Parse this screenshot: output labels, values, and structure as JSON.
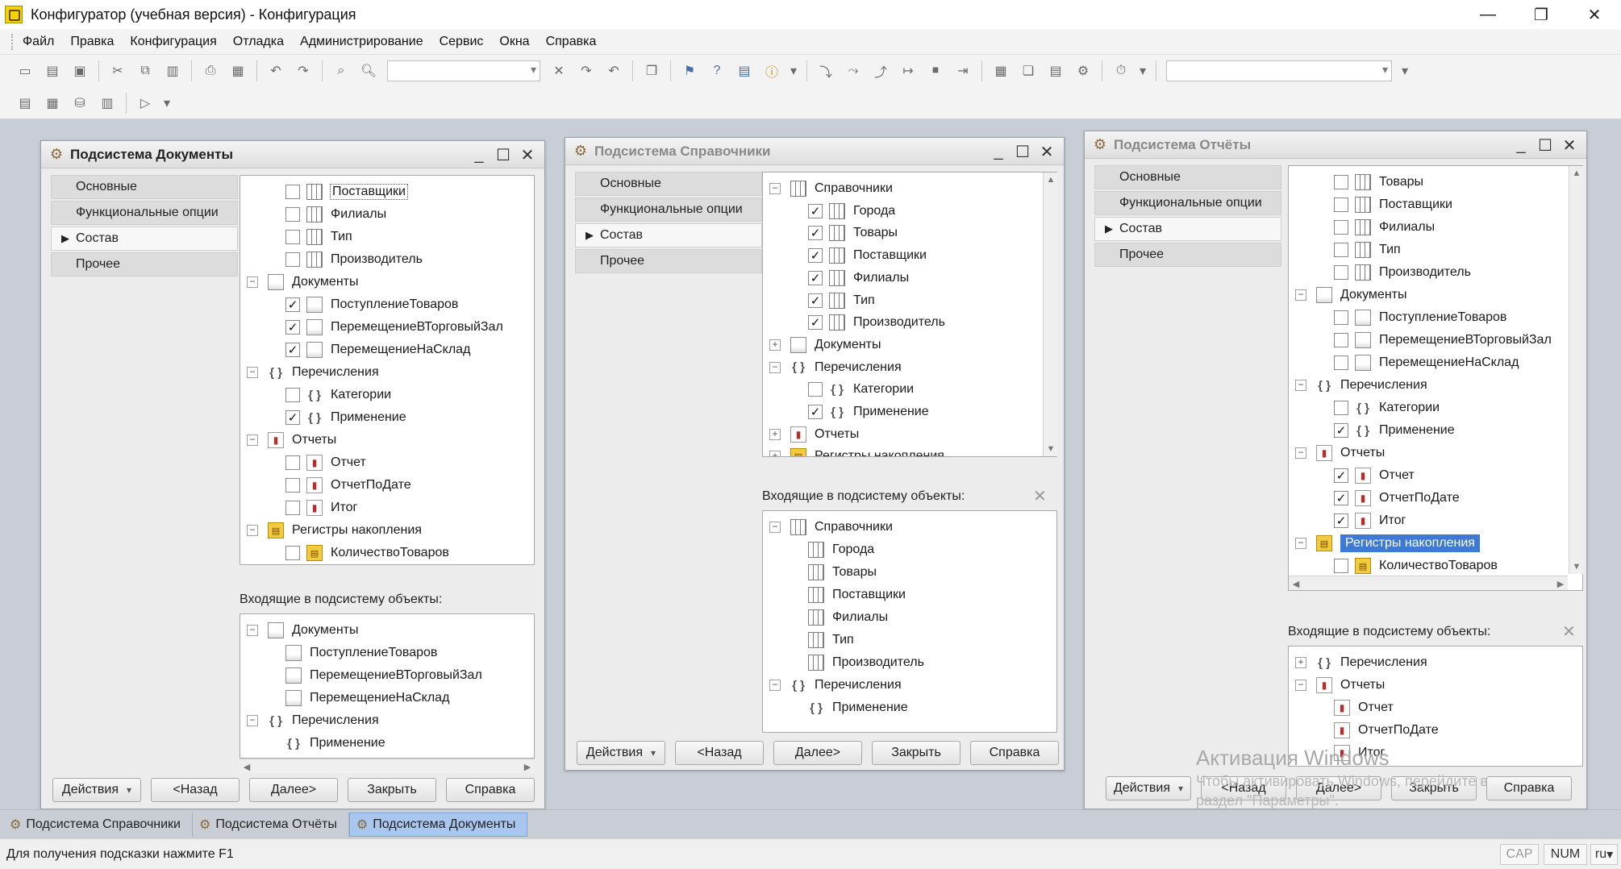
{
  "app": {
    "title": "Конфигуратор (учебная версия) - Конфигурация"
  },
  "menu": [
    "Файл",
    "Правка",
    "Конфигурация",
    "Отладка",
    "Администрирование",
    "Сервис",
    "Окна",
    "Справка"
  ],
  "tabs": [
    "Основные",
    "Функциональные опции",
    "Состав",
    "Прочее"
  ],
  "included_label": "Входящие в подсистему объекты:",
  "buttons": {
    "actions": "Действия",
    "back": "<Назад",
    "next": "Далее>",
    "close": "Закрыть",
    "help": "Справка"
  },
  "windows": {
    "documents": {
      "title": "Подсистема Документы",
      "tree": [
        {
          "level": 2,
          "check": "unchecked",
          "icon": "catalog",
          "label": "Поставщики",
          "focus": true
        },
        {
          "level": 2,
          "check": "unchecked",
          "icon": "catalog",
          "label": "Филиалы"
        },
        {
          "level": 2,
          "check": "unchecked",
          "icon": "catalog",
          "label": "Тип"
        },
        {
          "level": 2,
          "check": "unchecked",
          "icon": "catalog",
          "label": "Производитель"
        },
        {
          "level": 1,
          "expander": "−",
          "icon": "doc",
          "label": "Документы"
        },
        {
          "level": 2,
          "check": "checked",
          "icon": "doc",
          "label": "ПоступлениеТоваров"
        },
        {
          "level": 2,
          "check": "checked",
          "icon": "doc",
          "label": "ПеремещениеВТорговыйЗал"
        },
        {
          "level": 2,
          "check": "checked",
          "icon": "doc",
          "label": "ПеремещениеНаСклад"
        },
        {
          "level": 1,
          "expander": "−",
          "icon": "enum",
          "label": "Перечисления"
        },
        {
          "level": 2,
          "check": "unchecked",
          "icon": "enum",
          "label": "Категории"
        },
        {
          "level": 2,
          "check": "checked",
          "icon": "enum",
          "label": "Применение"
        },
        {
          "level": 1,
          "expander": "−",
          "icon": "report",
          "label": "Отчеты"
        },
        {
          "level": 2,
          "check": "unchecked",
          "icon": "report",
          "label": "Отчет"
        },
        {
          "level": 2,
          "check": "unchecked",
          "icon": "report",
          "label": "ОтчетПоДате"
        },
        {
          "level": 2,
          "check": "unchecked",
          "icon": "report",
          "label": "Итог"
        },
        {
          "level": 1,
          "expander": "−",
          "icon": "reg",
          "label": "Регистры накопления"
        },
        {
          "level": 2,
          "check": "unchecked",
          "icon": "reg",
          "label": "КоличествоТоваров"
        }
      ],
      "included": [
        {
          "level": 1,
          "expander": "−",
          "icon": "doc",
          "label": "Документы"
        },
        {
          "level": 2,
          "icon": "doc",
          "label": "ПоступлениеТоваров"
        },
        {
          "level": 2,
          "icon": "doc",
          "label": "ПеремещениеВТорговыйЗал"
        },
        {
          "level": 2,
          "icon": "doc",
          "label": "ПеремещениеНаСклад"
        },
        {
          "level": 1,
          "expander": "−",
          "icon": "enum",
          "label": "Перечисления"
        },
        {
          "level": 2,
          "icon": "enum",
          "label": "Применение"
        }
      ]
    },
    "catalogs": {
      "title": "Подсистема Справочники",
      "tree": [
        {
          "level": 1,
          "expander": "−",
          "icon": "catalog",
          "label": "Справочники"
        },
        {
          "level": 2,
          "check": "checked",
          "icon": "catalog",
          "label": "Города"
        },
        {
          "level": 2,
          "check": "checked",
          "icon": "catalog",
          "label": "Товары"
        },
        {
          "level": 2,
          "check": "checked",
          "icon": "catalog",
          "label": "Поставщики"
        },
        {
          "level": 2,
          "check": "checked",
          "icon": "catalog",
          "label": "Филиалы"
        },
        {
          "level": 2,
          "check": "checked",
          "icon": "catalog",
          "label": "Тип"
        },
        {
          "level": 2,
          "check": "checked",
          "icon": "catalog",
          "label": "Производитель"
        },
        {
          "level": 1,
          "expander": "+",
          "icon": "doc",
          "label": "Документы"
        },
        {
          "level": 1,
          "expander": "−",
          "icon": "enum",
          "label": "Перечисления"
        },
        {
          "level": 2,
          "check": "unchecked",
          "icon": "enum",
          "label": "Категории"
        },
        {
          "level": 2,
          "check": "checked",
          "icon": "enum",
          "label": "Применение"
        },
        {
          "level": 1,
          "expander": "+",
          "icon": "report",
          "label": "Отчеты"
        },
        {
          "level": 1,
          "expander": "+",
          "icon": "reg",
          "label": "Регистры накопления"
        }
      ],
      "included": [
        {
          "level": 1,
          "expander": "−",
          "icon": "catalog",
          "label": "Справочники"
        },
        {
          "level": 2,
          "icon": "catalog",
          "label": "Города"
        },
        {
          "level": 2,
          "icon": "catalog",
          "label": "Товары"
        },
        {
          "level": 2,
          "icon": "catalog",
          "label": "Поставщики"
        },
        {
          "level": 2,
          "icon": "catalog",
          "label": "Филиалы"
        },
        {
          "level": 2,
          "icon": "catalog",
          "label": "Тип"
        },
        {
          "level": 2,
          "icon": "catalog",
          "label": "Производитель"
        },
        {
          "level": 1,
          "expander": "−",
          "icon": "enum",
          "label": "Перечисления"
        },
        {
          "level": 2,
          "icon": "enum",
          "label": "Применение"
        }
      ]
    },
    "reports": {
      "title": "Подсистема Отчёты",
      "tree": [
        {
          "level": 2,
          "check": "unchecked",
          "icon": "catalog",
          "label": "Товары"
        },
        {
          "level": 2,
          "check": "unchecked",
          "icon": "catalog",
          "label": "Поставщики"
        },
        {
          "level": 2,
          "check": "unchecked",
          "icon": "catalog",
          "label": "Филиалы"
        },
        {
          "level": 2,
          "check": "unchecked",
          "icon": "catalog",
          "label": "Тип"
        },
        {
          "level": 2,
          "check": "unchecked",
          "icon": "catalog",
          "label": "Производитель"
        },
        {
          "level": 1,
          "expander": "−",
          "icon": "doc",
          "label": "Документы"
        },
        {
          "level": 2,
          "check": "unchecked",
          "icon": "doc",
          "label": "ПоступлениеТоваров"
        },
        {
          "level": 2,
          "check": "unchecked",
          "icon": "doc",
          "label": "ПеремещениеВТорговыйЗал"
        },
        {
          "level": 2,
          "check": "unchecked",
          "icon": "doc",
          "label": "ПеремещениеНаСклад"
        },
        {
          "level": 1,
          "expander": "−",
          "icon": "enum",
          "label": "Перечисления"
        },
        {
          "level": 2,
          "check": "unchecked",
          "icon": "enum",
          "label": "Категории"
        },
        {
          "level": 2,
          "check": "checked",
          "icon": "enum",
          "label": "Применение"
        },
        {
          "level": 1,
          "expander": "−",
          "icon": "report",
          "label": "Отчеты"
        },
        {
          "level": 2,
          "check": "checked",
          "icon": "report",
          "label": "Отчет"
        },
        {
          "level": 2,
          "check": "checked",
          "icon": "report",
          "label": "ОтчетПоДате"
        },
        {
          "level": 2,
          "check": "checked",
          "icon": "report",
          "label": "Итог"
        },
        {
          "level": 1,
          "expander": "−",
          "icon": "reg",
          "label": "Регистры накопления",
          "selected": true
        },
        {
          "level": 2,
          "check": "unchecked",
          "icon": "reg",
          "label": "КоличествоТоваров"
        }
      ],
      "included": [
        {
          "level": 1,
          "expander": "+",
          "icon": "enum",
          "label": "Перечисления"
        },
        {
          "level": 1,
          "expander": "−",
          "icon": "report",
          "label": "Отчеты"
        },
        {
          "level": 2,
          "icon": "report",
          "label": "Отчет"
        },
        {
          "level": 2,
          "icon": "report",
          "label": "ОтчетПоДате"
        },
        {
          "level": 2,
          "icon": "report",
          "label": "Итог"
        }
      ]
    }
  },
  "watermark": {
    "line1": "Активация Windows",
    "line2": "Чтобы активировать Windows, перейдите в",
    "line3": "раздел \"Параметры\"."
  },
  "taskbar": [
    "Подсистема Справочники",
    "Подсистема Отчёты",
    "Подсистема Документы"
  ],
  "status": {
    "hint": "Для получения подсказки нажмите F1",
    "cap": "CAP",
    "num": "NUM",
    "lang": "ru"
  }
}
